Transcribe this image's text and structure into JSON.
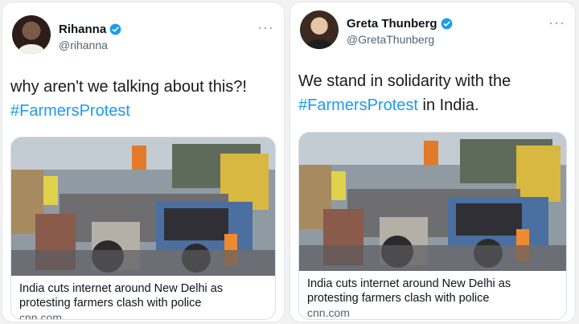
{
  "tweets": [
    {
      "name": "Rihanna",
      "handle": "@rihanna",
      "text_plain": "why aren't we talking about this?!",
      "hashtag": "#FarmersProtest",
      "text_suffix": "",
      "card": {
        "title_line1": "India cuts internet around New Delhi as",
        "title_line2": "protesting farmers clash with police",
        "domain": "cnn.com"
      }
    },
    {
      "name": "Greta Thunberg",
      "handle": "@GretaThunberg",
      "text_plain": "We stand in solidarity with the",
      "hashtag": "#FarmersProtest",
      "text_suffix": " in India.",
      "card": {
        "title_line1": "India cuts internet around New Delhi as",
        "title_line2": "protesting farmers clash with police",
        "domain": "cnn.com"
      }
    }
  ],
  "icons": {
    "verified": "verified-badge-icon",
    "more": "more-options-icon"
  },
  "colors": {
    "hashtag": "#1d9bf0",
    "verified": "#1d9bf0",
    "handle": "#536471"
  }
}
